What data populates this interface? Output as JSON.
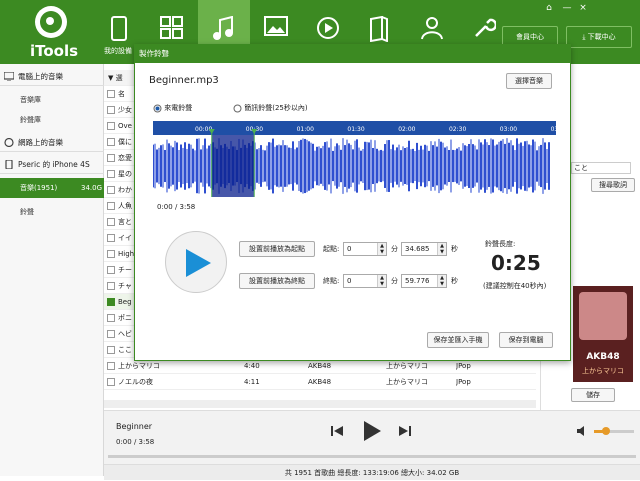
{
  "app": {
    "brand": "iTools",
    "nav_label": "我的設備",
    "btn_member": "會員中心",
    "btn_download": "下載中心"
  },
  "window_controls": [
    "⌂",
    "—",
    "×"
  ],
  "sidebar": {
    "sec_computer": "電腦上的音樂",
    "computer_items": [
      "音樂庫",
      "鈴聲庫"
    ],
    "sec_online": "網路上的音樂",
    "device": "Pseric 的 iPhone 4S",
    "device_items": [
      {
        "label": "音樂(1951)",
        "size": "34.0G"
      },
      {
        "label": "鈴聲",
        "size": ""
      }
    ]
  },
  "list": {
    "header": "▼  選",
    "rows": [
      {
        "title": "名",
        "checked": false
      },
      {
        "title": "少女",
        "checked": false
      },
      {
        "title": "Ove",
        "checked": false
      },
      {
        "title": "僕に",
        "checked": false
      },
      {
        "title": "恋愛",
        "checked": false
      },
      {
        "title": "星の",
        "checked": false
      },
      {
        "title": "わか",
        "checked": false
      },
      {
        "title": "人魚",
        "checked": false
      },
      {
        "title": "言と",
        "checked": false
      },
      {
        "title": "イイ",
        "checked": false
      },
      {
        "title": "High",
        "checked": false
      },
      {
        "title": "チー",
        "checked": false
      },
      {
        "title": "チャ",
        "checked": false
      },
      {
        "title": "Beg",
        "checked": true
      },
      {
        "title": "ポニ",
        "checked": false
      },
      {
        "title": "ヘビ",
        "checked": false
      },
      {
        "title": "ここ",
        "checked": false
      },
      {
        "title": "上からマリコ",
        "checked": false,
        "time": "4:40",
        "artist": "AKB48",
        "album": "上からマリコ",
        "genre": "JPop"
      },
      {
        "title": "ノエルの夜",
        "checked": false,
        "time": "4:11",
        "artist": "AKB48",
        "album": "上からマリコ",
        "genre": "JPop"
      }
    ]
  },
  "right_pane": {
    "lyrics_text": "こと",
    "lyrics_btn": "搜尋歌詞",
    "album_caption": "AKB48",
    "album_subcaption": "上からマリコ",
    "save_btn": "儲存"
  },
  "player": {
    "song": "Beginner",
    "time": "0:00 / 3:58",
    "progress": 0,
    "volume": 0.3
  },
  "status": "共 1951 首歌曲  總長度: 133:19:06  總大小: 34.02 GB",
  "dialog": {
    "title": "製作鈴聲",
    "filename": "Beginner.mp3",
    "select_btn": "選擇音樂",
    "radio_incoming": "來電鈴聲",
    "radio_sms": "簡訊鈴聲(25秒以內)",
    "incoming_selected": true,
    "ticks": [
      "00:00",
      "00:30",
      "01:00",
      "01:30",
      "02:00",
      "02:30",
      "03:00",
      "03:30"
    ],
    "time_display": "0:00 / 3:58",
    "selection": {
      "start_sec": 34.685,
      "end_sec": 59.776,
      "total_sec": 238
    },
    "btn_set_start": "設置前播放為起點",
    "btn_set_end": "設置前播放為終點",
    "start_label": "起點:",
    "end_label": "終點:",
    "start_min": "0",
    "start_sec": "34.685",
    "end_min": "0",
    "end_sec": "59.776",
    "unit_min": "分",
    "unit_sec": "秒",
    "length_label": "鈴聲長度:",
    "length_value": "0:25",
    "length_hint": "(建議控制在40秒內)",
    "btn_save_phone": "保存並匯入手機",
    "btn_save_pc": "保存到電腦"
  },
  "colors": {
    "brand": "#3c8a22",
    "waveform": "#2f4fd0",
    "wave_bar": "#1f4fa6"
  }
}
